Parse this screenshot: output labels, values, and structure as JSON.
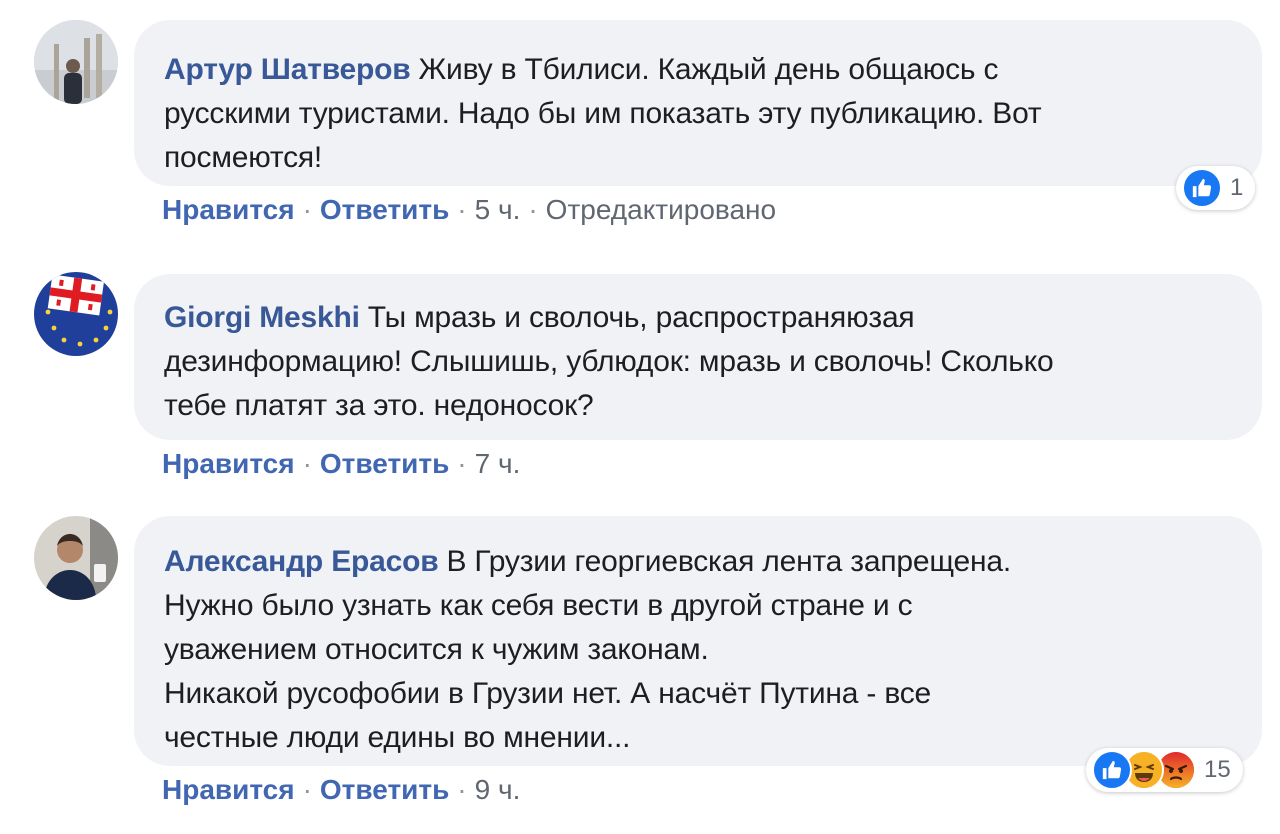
{
  "comments": [
    {
      "author": "Артур Шатверов",
      "lines": [
        "Живу в Тбилиси. Каждый день общаюсь с",
        "русскими туристами. Надо бы им показать эту публикацию. Вот",
        "посмеются!"
      ],
      "like_label": "Нравится",
      "reply_label": "Ответить",
      "time": "5 ч.",
      "edited": "Отредактировано",
      "reactions": [
        "like-icon"
      ],
      "reaction_count": "1"
    },
    {
      "author": "Giorgi Meskhi",
      "lines": [
        "Ты мразь и сволочь, распространяюзая",
        "дезинформацию! Слышишь, ублюдок: мразь и сволочь! Сколько",
        "тебе платят за это. недоносок?"
      ],
      "like_label": "Нравится",
      "reply_label": "Ответить",
      "time": "7 ч."
    },
    {
      "author": "Александр Ерасов",
      "lines": [
        "В Грузии георгиевская лента запрещена.",
        "Нужно было узнать как себя вести в другой стране и с",
        "уважением относится к чужим законам.",
        "Никакой русофобии в Грузии нет. А насчёт Путина - все",
        "честные люди едины во мнении..."
      ],
      "like_label": "Нравится",
      "reply_label": "Ответить",
      "time": "9 ч.",
      "reactions": [
        "like-icon",
        "haha-icon",
        "angry-icon"
      ],
      "reaction_count": "15"
    }
  ],
  "colors": {
    "author": "#385898",
    "link": "#4267b2",
    "bubble": "#f0f2f5",
    "like": "#1877f2",
    "haha": "#f7b125",
    "angry": "#e9710f"
  }
}
